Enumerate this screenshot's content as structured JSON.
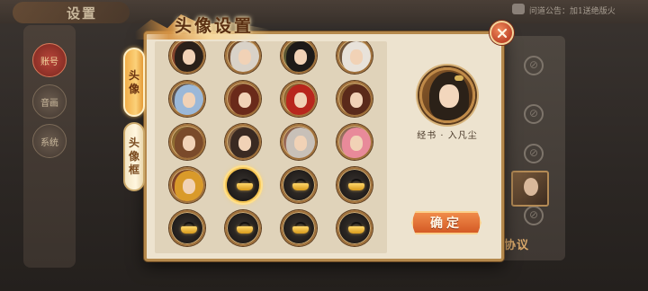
{
  "background": {
    "title": "设置",
    "nav": [
      {
        "label": "账号",
        "active": true
      },
      {
        "label": "音画",
        "active": false
      },
      {
        "label": "系统",
        "active": false
      }
    ],
    "notice": "问道公告：加1送绝版火",
    "side_button_label": "协议",
    "ban_icon": "ban-icon"
  },
  "modal": {
    "title": "头像设置",
    "close_icon": "close-icon",
    "tabs": [
      {
        "label": [
          "头",
          "像"
        ],
        "active": true
      },
      {
        "label": [
          "头",
          "像",
          "框"
        ],
        "active": false
      }
    ],
    "avatars": [
      {
        "locked": false,
        "hair": "#2a2019",
        "accent": "#b33a2b"
      },
      {
        "locked": false,
        "hair": "#d9d2c8",
        "accent": "#8a5a3a"
      },
      {
        "locked": false,
        "hair": "#1d1a18",
        "accent": "#3f6a3a"
      },
      {
        "locked": false,
        "hair": "#e8e2da",
        "accent": "#7a6a5a"
      },
      {
        "locked": false,
        "hair": "#9bb8d8",
        "accent": "#4a6a9a"
      },
      {
        "locked": false,
        "hair": "#6a2a1a",
        "accent": "#c2582e"
      },
      {
        "locked": false,
        "hair": "#b8261d",
        "accent": "#e0a040"
      },
      {
        "locked": false,
        "hair": "#5a2a1a",
        "accent": "#c98a3a"
      },
      {
        "locked": false,
        "hair": "#7a4a2a",
        "accent": "#c9a23a"
      },
      {
        "locked": false,
        "hair": "#3a2a22",
        "accent": "#b89a7a"
      },
      {
        "locked": false,
        "hair": "#c8c0b8",
        "accent": "#e7a0a0"
      },
      {
        "locked": false,
        "hair": "#e88a9a",
        "accent": "#f3c1c8"
      },
      {
        "locked": false,
        "hair": "#d99a2a",
        "accent": "#a8321e"
      },
      {
        "locked": true,
        "selected": true
      },
      {
        "locked": true
      },
      {
        "locked": true
      },
      {
        "locked": true
      },
      {
        "locked": true
      },
      {
        "locked": true
      },
      {
        "locked": true
      }
    ],
    "preview_name": "经书 · 入凡尘",
    "confirm_label": "确定"
  }
}
